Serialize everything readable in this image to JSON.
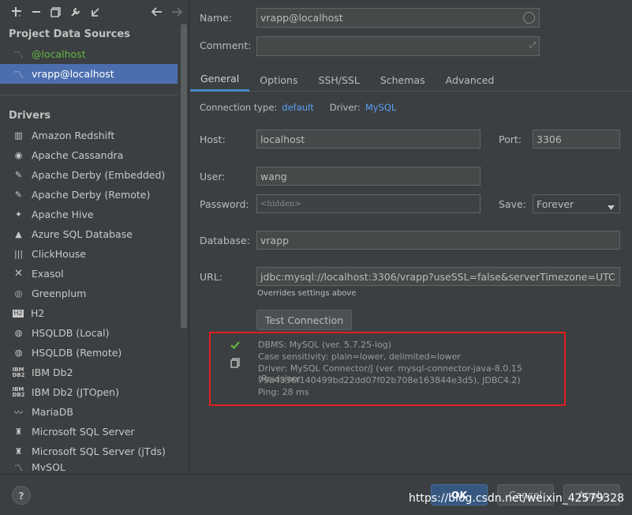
{
  "toolbar": {
    "icons": [
      "add-icon",
      "remove-icon",
      "duplicate-icon",
      "wrench-icon",
      "import-icon",
      "back-arrow-icon",
      "forward-arrow-icon"
    ]
  },
  "sidebar": {
    "project_title": "Project Data Sources",
    "data_sources": [
      {
        "label": "@localhost"
      },
      {
        "label": "vrapp@localhost"
      }
    ],
    "drivers_title": "Drivers",
    "drivers": [
      {
        "label": "Amazon Redshift"
      },
      {
        "label": "Apache Cassandra"
      },
      {
        "label": "Apache Derby (Embedded)"
      },
      {
        "label": "Apache Derby (Remote)"
      },
      {
        "label": "Apache Hive"
      },
      {
        "label": "Azure SQL Database"
      },
      {
        "label": "ClickHouse"
      },
      {
        "label": "Exasol"
      },
      {
        "label": "Greenplum"
      },
      {
        "label": "H2"
      },
      {
        "label": "HSQLDB (Local)"
      },
      {
        "label": "HSQLDB (Remote)"
      },
      {
        "label": "IBM Db2"
      },
      {
        "label": "IBM Db2 (JTOpen)"
      },
      {
        "label": "MariaDB"
      },
      {
        "label": "Microsoft SQL Server"
      },
      {
        "label": "Microsoft SQL Server (jTds)"
      },
      {
        "label": "MySQL"
      }
    ]
  },
  "form": {
    "name_label": "Name:",
    "name_value": "vrapp@localhost",
    "comment_label": "Comment:",
    "comment_value": "",
    "tabs": [
      "General",
      "Options",
      "SSH/SSL",
      "Schemas",
      "Advanced"
    ],
    "conn_type_label": "Connection type:",
    "conn_type_value": "default",
    "driver_label": "Driver:",
    "driver_value": "MySQL",
    "host_label": "Host:",
    "host_value": "localhost",
    "port_label": "Port:",
    "port_value": "3306",
    "user_label": "User:",
    "user_value": "wang",
    "password_label": "Password:",
    "password_value": "<hidden>",
    "save_label": "Save:",
    "save_value": "Forever",
    "database_label": "Database:",
    "database_value": "vrapp",
    "url_label": "URL:",
    "url_value": "jdbc:mysql://localhost:3306/vrapp?useSSL=false&serverTimezone=UTC",
    "url_hint": "Overrides settings above",
    "test_button": "Test Connection"
  },
  "result": {
    "line1": "DBMS: MySQL (ver. 5.7.25-log)",
    "line2": "Case sensitivity: plain=lower, delimited=lower",
    "line3": "Driver: MySQL Connector/J (ver. mysql-connector-java-8.0.15 (Revision:",
    "line4": "79a4336f140499bd22dd07f02b708e163844e3d5), JDBC4.2)",
    "line5": "Ping: 28 ms"
  },
  "footer": {
    "help": "?",
    "ok": "OK",
    "cancel": "Cancel",
    "apply": "Apply",
    "watermark": "https://blog.csdn.net/weixin_42579328"
  },
  "colors": {
    "accent": "#4b6eaf",
    "link": "#589df6",
    "success": "#62b543",
    "highlight_box": "#e0201e"
  }
}
